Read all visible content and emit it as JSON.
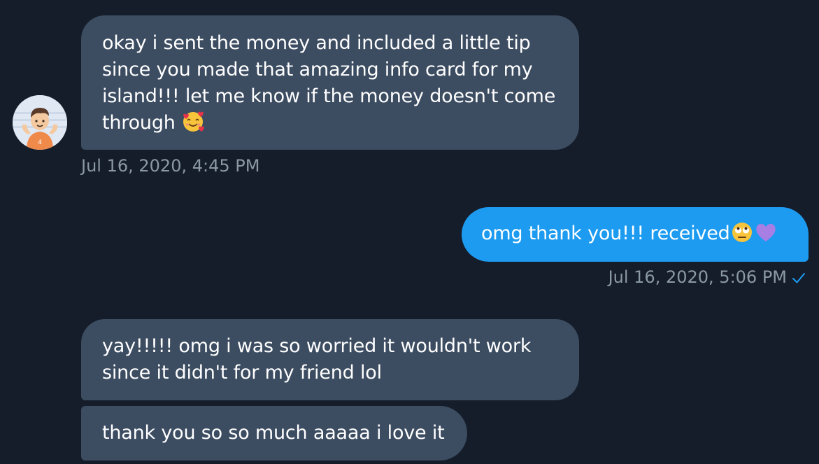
{
  "messages": [
    {
      "direction": "incoming",
      "text": "okay i sent the money and included a little tip since you made that amazing info card for my island!!! let me know if the money doesn't come through",
      "emoji": "smiling-face-with-hearts",
      "timestamp": "Jul 16, 2020, 4:45 PM"
    },
    {
      "direction": "outgoing",
      "text": "omg thank you!!! received",
      "emoji": [
        "face-with-rolling-eyes",
        "purple-heart"
      ],
      "timestamp": "Jul 16, 2020, 5:06 PM",
      "status": "sent"
    },
    {
      "direction": "incoming",
      "text": "yay!!!!! omg i was so worried it wouldn't work since it didn't for my friend lol"
    },
    {
      "direction": "incoming",
      "text": "thank you so so much aaaaa i love it"
    }
  ],
  "colors": {
    "background": "#151d2a",
    "incoming_bubble": "#3c4c61",
    "outgoing_bubble": "#1d9bf0",
    "timestamp": "#8b98a5",
    "check": "#1d9bf0"
  },
  "avatar": {
    "icon": "cartoon-person-avatar",
    "badge": "4"
  }
}
